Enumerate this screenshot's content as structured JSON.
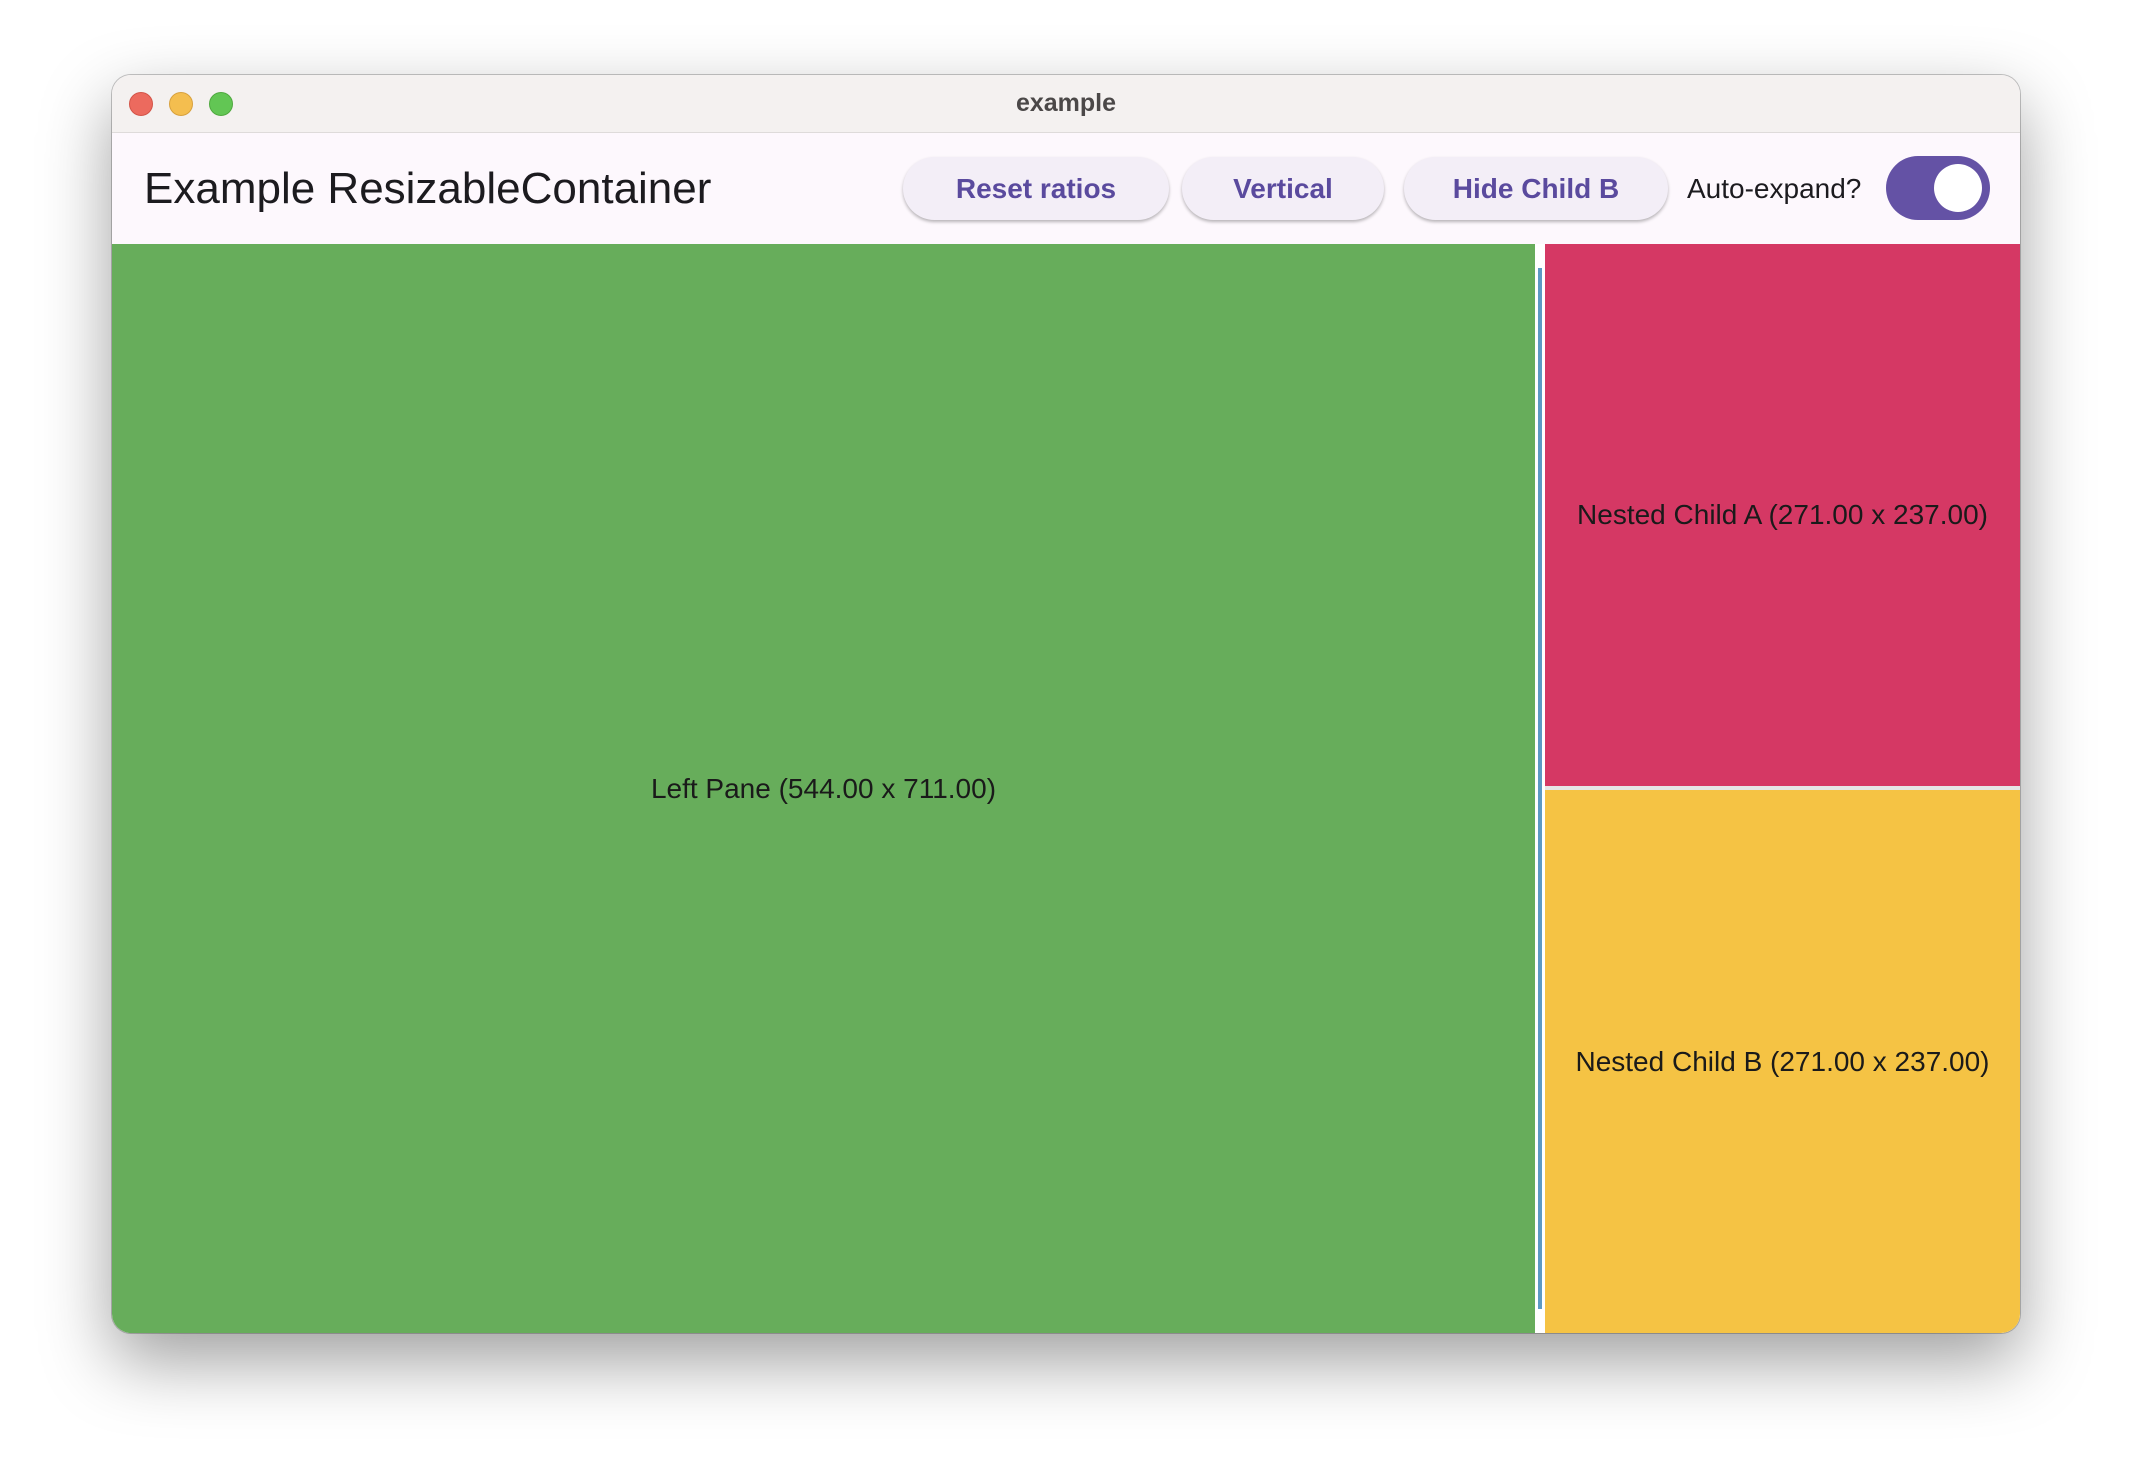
{
  "window": {
    "title": "example"
  },
  "appbar": {
    "title": "Example ResizableContainer",
    "buttons": {
      "reset_ratios": "Reset ratios",
      "vertical": "Vertical",
      "hide_child_b": "Hide Child B"
    },
    "auto_expand": {
      "label": "Auto-expand?",
      "checked": true
    }
  },
  "panes": {
    "left": {
      "label": "Left Pane (544.00 x 711.00)",
      "color": "#67ad5b"
    },
    "nested_a": {
      "label": "Nested Child A (271.00 x 237.00)",
      "color": "#d53864"
    },
    "nested_b": {
      "label": "Nested Child B (271.00 x 237.00)",
      "color": "#f5c344"
    }
  },
  "colors": {
    "accent": "#6452a5",
    "button_text": "#5a4a9e",
    "divider_highlight": "#5d9ac4"
  }
}
